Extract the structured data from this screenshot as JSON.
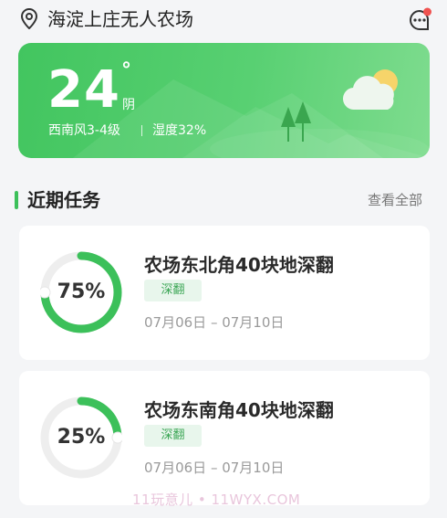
{
  "header": {
    "location": "海淀上庄无人农场"
  },
  "weather": {
    "temperature": "24",
    "degree_symbol": "°",
    "condition": "阴",
    "wind": "西南风3-4级",
    "humidity": "湿度32%"
  },
  "section": {
    "title": "近期任务",
    "view_all": "查看全部"
  },
  "tasks": [
    {
      "name": "农场东北角40块地深翻",
      "tag": "深翻",
      "dates": "07月06日 – 07月10日",
      "progress_label": "75%",
      "progress": 0.75
    },
    {
      "name": "农场东南角40块地深翻",
      "tag": "深翻",
      "dates": "07月06日 – 07月10日",
      "progress_label": "25%",
      "progress": 0.25
    }
  ],
  "watermark": "11玩意儿 • 11WYX.COM",
  "colors": {
    "accent": "#3cc05a",
    "weather_card": "#4fca68",
    "ring_track": "#eeeeee",
    "notification_dot": "#f0524f"
  }
}
